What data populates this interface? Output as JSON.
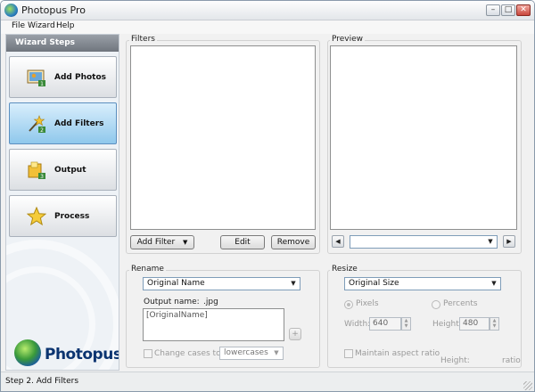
{
  "window": {
    "title": "Photopus Pro",
    "minimize": "–",
    "maximize": "□",
    "close": "✕"
  },
  "menu": [
    "File",
    "Wizard",
    "Help"
  ],
  "sidebar": {
    "header": "Wizard Steps",
    "steps": [
      {
        "label": "Add Photos",
        "icon": "photo-icon",
        "active": false
      },
      {
        "label": "Add Filters",
        "icon": "wand-icon",
        "active": true
      },
      {
        "label": "Output",
        "icon": "folder-icon",
        "active": false
      },
      {
        "label": "Process",
        "icon": "star-icon",
        "active": false
      }
    ],
    "logo": "Photopus"
  },
  "filters": {
    "label": "Filters",
    "add_filter": "Add Filter",
    "edit": "Edit",
    "remove": "Remove"
  },
  "preview": {
    "label": "Preview",
    "selected": ""
  },
  "rename": {
    "label": "Rename",
    "mode": "Original Name",
    "output_name_label": "Output name:",
    "output_name_value": ".jpg",
    "template_text": "[OriginalName]",
    "add_icon": "+",
    "change_cases_label": "Change cases to:",
    "case_value": "lowercases"
  },
  "resize": {
    "label": "Resize",
    "mode": "Original Size",
    "pixels_label": "Pixels",
    "percents_label": "Percents",
    "width_label": "Width:",
    "width_value": "640",
    "height_label": "Height:",
    "height_value": "480",
    "aspect_label": "Maintain aspect ratio",
    "height_ratio_label": "Height:",
    "ratio_label": "ratio",
    "pixels_checked": true
  },
  "status": {
    "text": "Step 2. Add Filters"
  },
  "colors": {
    "accent": "#8fc8ec",
    "logo": "#0b3470"
  }
}
